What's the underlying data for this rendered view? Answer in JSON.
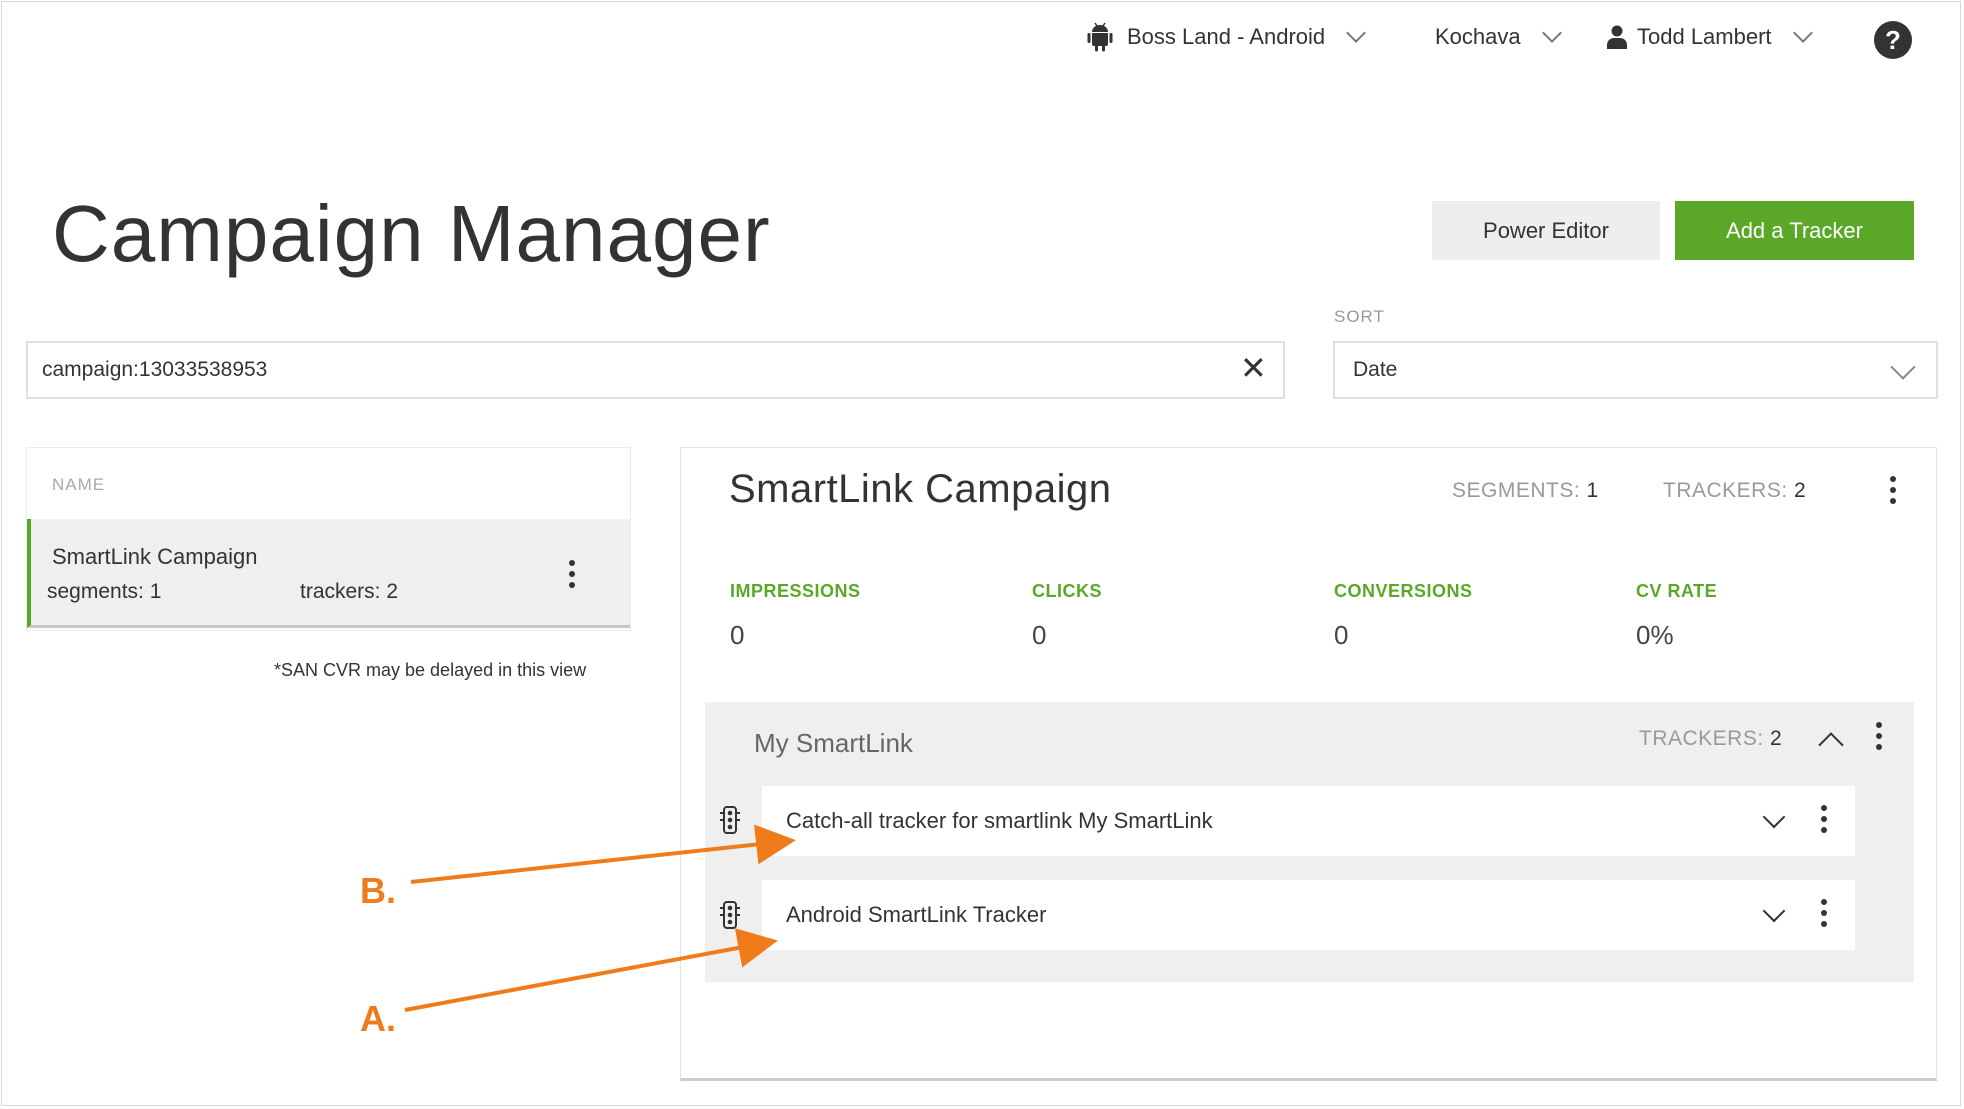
{
  "topbar": {
    "app_name": "Boss Land - Android",
    "account": "Kochava",
    "user": "Todd Lambert",
    "help_glyph": "?"
  },
  "page": {
    "title": "Campaign Manager",
    "power_editor_label": "Power Editor",
    "add_tracker_label": "Add a Tracker",
    "accent_color": "#5ba829"
  },
  "search": {
    "value": "campaign:13033538953",
    "clear_glyph": "✕"
  },
  "sort": {
    "label": "SORT",
    "value": "Date"
  },
  "list": {
    "header": "NAME",
    "items": [
      {
        "name": "SmartLink Campaign",
        "segments": "segments: 1",
        "trackers": "trackers: 2"
      }
    ],
    "footnote": "*SAN CVR may be delayed in this view"
  },
  "detail": {
    "title": "SmartLink Campaign",
    "segments_label": "SEGMENTS:",
    "segments_value": "1",
    "trackers_label": "TRACKERS:",
    "trackers_value": "2",
    "stats": [
      {
        "label": "IMPRESSIONS",
        "value": "0"
      },
      {
        "label": "CLICKS",
        "value": "0"
      },
      {
        "label": "CONVERSIONS",
        "value": "0"
      },
      {
        "label": "CV RATE",
        "value": "0%"
      }
    ],
    "segment": {
      "title": "My SmartLink",
      "trackers_label": "TRACKERS:",
      "trackers_value": "2",
      "trackers": [
        {
          "name": "Catch-all tracker for smartlink My SmartLink"
        },
        {
          "name": "Android SmartLink Tracker"
        }
      ]
    }
  },
  "annotations": {
    "b_label": "B.",
    "a_label": "A.",
    "color": "#f07b1b"
  }
}
